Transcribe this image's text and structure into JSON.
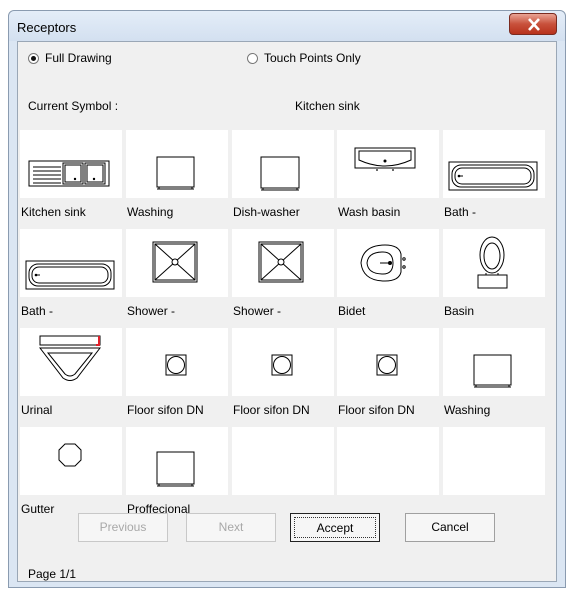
{
  "window": {
    "title": "Receptors"
  },
  "options": {
    "full_drawing": "Full Drawing",
    "touch_points": "Touch Points Only",
    "selected": "full_drawing"
  },
  "current_symbol": {
    "label": "Current Symbol :",
    "value": "Kitchen sink"
  },
  "symbols": [
    {
      "label": "Kitchen sink",
      "icon": "kitchen-sink-icon"
    },
    {
      "label": "Washing",
      "icon": "washing-machine-icon"
    },
    {
      "label": "Dish-washer",
      "icon": "dishwasher-icon"
    },
    {
      "label": "Wash basin",
      "icon": "wash-basin-icon"
    },
    {
      "label": "Bath -",
      "icon": "bathtub-icon"
    },
    {
      "label": "Bath -",
      "icon": "bathtub-icon"
    },
    {
      "label": "Shower -",
      "icon": "shower-tray-icon"
    },
    {
      "label": "Shower -",
      "icon": "shower-tray-icon"
    },
    {
      "label": "Bidet",
      "icon": "bidet-icon"
    },
    {
      "label": "Basin",
      "icon": "toilet-icon"
    },
    {
      "label": "Urinal",
      "icon": "urinal-icon"
    },
    {
      "label": "Floor sifon DN",
      "icon": "floor-drain-icon"
    },
    {
      "label": "Floor sifon DN",
      "icon": "floor-drain-icon"
    },
    {
      "label": "Floor sifon DN",
      "icon": "floor-drain-icon"
    },
    {
      "label": "Washing",
      "icon": "washing-machine-icon"
    },
    {
      "label": "Gutter",
      "icon": "gutter-icon"
    },
    {
      "label": "Proffecional",
      "icon": "professional-washer-icon"
    },
    {
      "label": "",
      "icon": ""
    },
    {
      "label": "",
      "icon": ""
    },
    {
      "label": "",
      "icon": ""
    }
  ],
  "buttons": {
    "previous": "Previous",
    "next": "Next",
    "accept": "Accept",
    "cancel": "Cancel"
  },
  "page": "Page 1/1",
  "colors": {
    "close_button": "#c8513c",
    "urinal_accent": "#e0202a"
  }
}
